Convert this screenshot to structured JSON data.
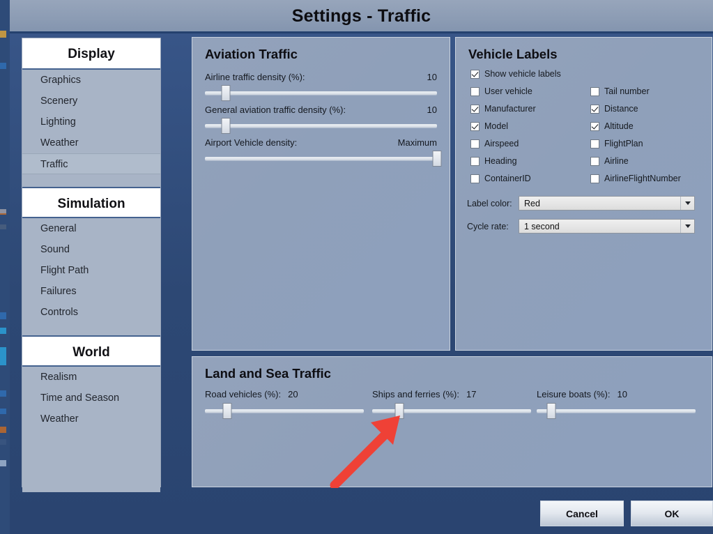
{
  "window": {
    "title": "Settings - Traffic"
  },
  "sidebar": {
    "sections": [
      {
        "header": "Display",
        "items": [
          "Graphics",
          "Scenery",
          "Lighting",
          "Weather",
          "Traffic"
        ],
        "selected": "Traffic"
      },
      {
        "header": "Simulation",
        "items": [
          "General",
          "Sound",
          "Flight Path",
          "Failures",
          "Controls"
        ],
        "selected": null
      },
      {
        "header": "World",
        "items": [
          "Realism",
          "Time and Season",
          "Weather"
        ],
        "selected": null
      }
    ]
  },
  "aviation": {
    "title": "Aviation Traffic",
    "sliders": [
      {
        "label": "Airline traffic density (%):",
        "value": "10",
        "pct": 9
      },
      {
        "label": "General aviation traffic density (%):",
        "value": "10",
        "pct": 9
      },
      {
        "label": "Airport Vehicle density:",
        "value": "Maximum",
        "pct": 100
      }
    ]
  },
  "labels": {
    "title": "Vehicle Labels",
    "checkboxes": [
      {
        "label": "Show vehicle labels",
        "checked": true,
        "col": 0,
        "row": 0
      },
      {
        "label": "User vehicle",
        "checked": false,
        "col": 0,
        "row": 1
      },
      {
        "label": "Manufacturer",
        "checked": true,
        "col": 0,
        "row": 2
      },
      {
        "label": "Model",
        "checked": true,
        "col": 0,
        "row": 3
      },
      {
        "label": "Airspeed",
        "checked": false,
        "col": 0,
        "row": 4
      },
      {
        "label": "Heading",
        "checked": false,
        "col": 0,
        "row": 5
      },
      {
        "label": "ContainerID",
        "checked": false,
        "col": 0,
        "row": 6
      },
      {
        "label": "Tail number",
        "checked": false,
        "col": 1,
        "row": 1
      },
      {
        "label": "Distance",
        "checked": true,
        "col": 1,
        "row": 2
      },
      {
        "label": "Altitude",
        "checked": true,
        "col": 1,
        "row": 3
      },
      {
        "label": "FlightPlan",
        "checked": false,
        "col": 1,
        "row": 4
      },
      {
        "label": "Airline",
        "checked": false,
        "col": 1,
        "row": 5
      },
      {
        "label": "AirlineFlightNumber",
        "checked": false,
        "col": 1,
        "row": 6
      }
    ],
    "dropdowns": [
      {
        "label": "Label color:",
        "value": "Red"
      },
      {
        "label": "Cycle rate:",
        "value": "1 second"
      }
    ]
  },
  "land_sea": {
    "title": "Land and Sea Traffic",
    "sliders": [
      {
        "label": "Road vehicles (%):",
        "value": "20",
        "pct": 14
      },
      {
        "label": "Ships and ferries (%):",
        "value": "17",
        "pct": 17
      },
      {
        "label": "Leisure boats (%):",
        "value": "10",
        "pct": 9
      }
    ]
  },
  "footer": {
    "cancel": "Cancel",
    "ok": "OK"
  },
  "annotation": {
    "arrow_color": "#ef4136",
    "points_to": "ships-and-ferries-slider-handle"
  }
}
